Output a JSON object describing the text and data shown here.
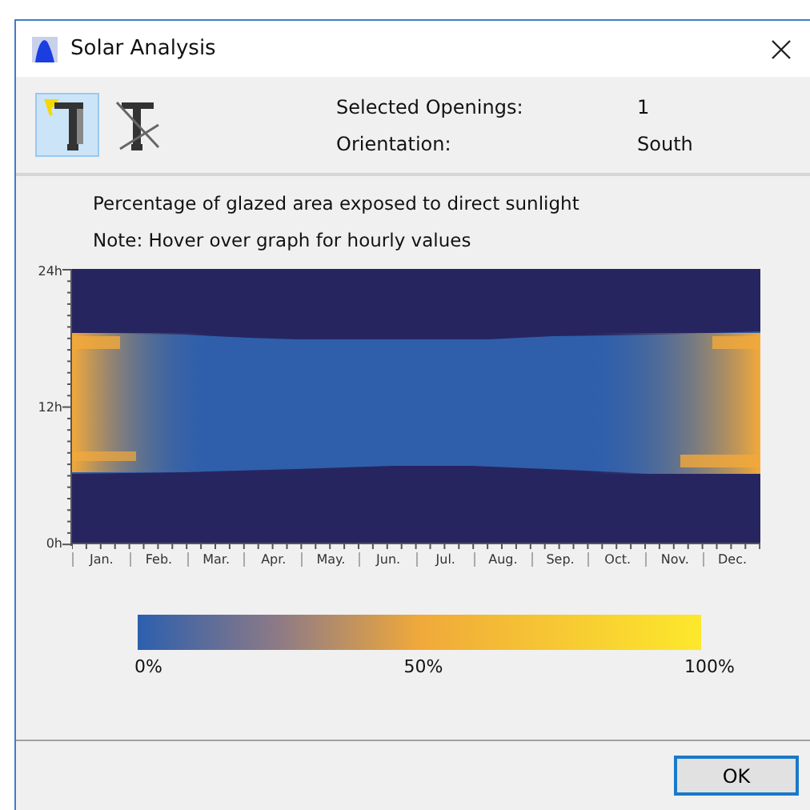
{
  "window": {
    "title": "Solar Analysis"
  },
  "tools": [
    {
      "kind": "sun",
      "selected": true
    },
    {
      "kind": "shade",
      "selected": false
    }
  ],
  "info": [
    {
      "label": "Selected Openings:",
      "value": "1"
    },
    {
      "label": "Orientation:",
      "value": "South"
    }
  ],
  "description": "Percentage of glazed area exposed to direct sunlight",
  "note": "Note: Hover over graph for hourly values",
  "heatmap": {
    "y_labels": [
      "24h",
      "12h",
      "0h"
    ],
    "months": [
      "Jan.",
      "Feb.",
      "Mar.",
      "Apr.",
      "May.",
      "Jun.",
      "Jul.",
      "Aug.",
      "Sep.",
      "Oct.",
      "Nov.",
      "Dec."
    ]
  },
  "legend": {
    "labels": [
      "0%",
      "50%",
      "100%"
    ]
  },
  "buttons": [
    "OK"
  ]
}
